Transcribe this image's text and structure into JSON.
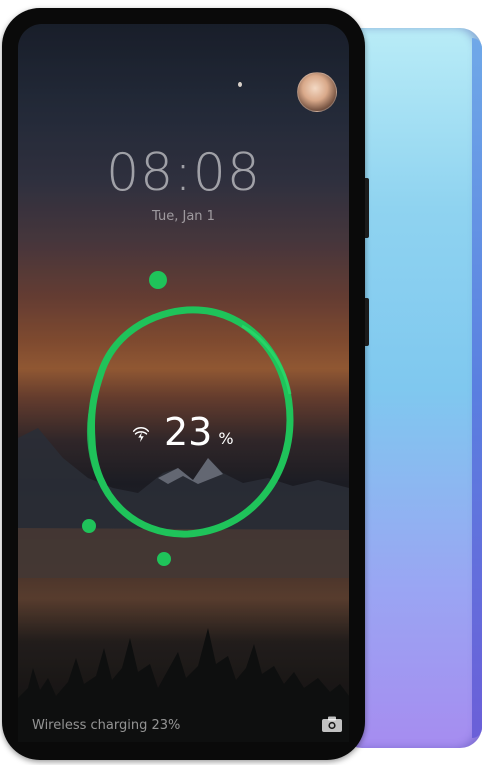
{
  "lockscreen": {
    "time": "08:08",
    "date": "Tue, Jan 1"
  },
  "charging": {
    "percent_value": "23",
    "percent_sign": "%",
    "level_fraction": 0.23,
    "status_text": "Wireless charging 23%",
    "ring_color": "#1fc35a"
  },
  "icons": {
    "charge": "wireless-charging-icon",
    "camera": "camera-icon",
    "avatar": "user-avatar"
  }
}
